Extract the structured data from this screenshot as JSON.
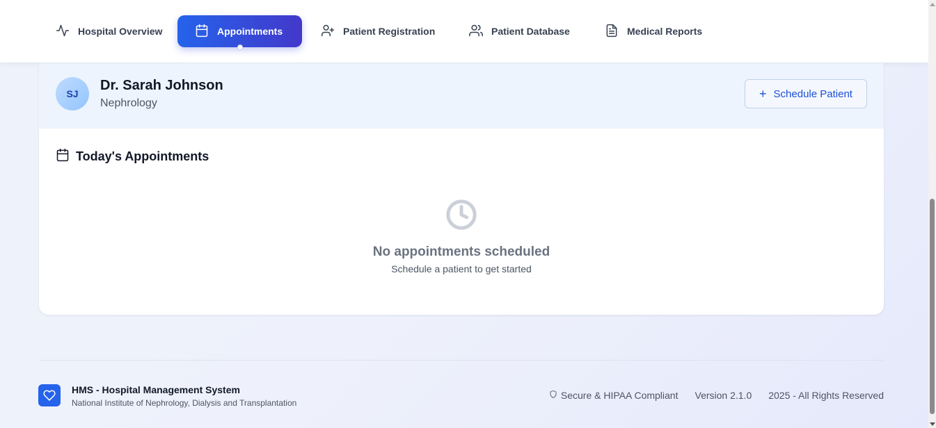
{
  "nav": {
    "tabs": [
      {
        "label": "Hospital Overview",
        "icon": "activity-icon",
        "active": false
      },
      {
        "label": "Appointments",
        "icon": "calendar-icon",
        "active": true
      },
      {
        "label": "Patient Registration",
        "icon": "user-plus-icon",
        "active": false
      },
      {
        "label": "Patient Database",
        "icon": "users-icon",
        "active": false
      },
      {
        "label": "Medical Reports",
        "icon": "file-text-icon",
        "active": false
      }
    ]
  },
  "doctor": {
    "initials": "SJ",
    "name": "Dr. Sarah Johnson",
    "specialty": "Nephrology",
    "schedule_button_label": "Schedule Patient",
    "schedule_button_icon": "plus-icon"
  },
  "appointments": {
    "title": "Today's Appointments",
    "title_icon": "calendar-icon",
    "empty_icon": "clock-icon",
    "empty_title": "No appointments scheduled",
    "empty_subtitle": "Schedule a patient to get started"
  },
  "footer": {
    "logo_icon": "heart-icon",
    "title": "HMS - Hospital Management System",
    "subtitle": "National Institute of Nephrology, Dialysis and Transplantation",
    "secure_icon": "shield-icon",
    "secure_label": "Secure & HIPAA Compliant",
    "version": "Version 2.1.0",
    "copyright": "2025 - All Rights Reserved"
  },
  "colors": {
    "accent": "#2563eb",
    "accent_end": "#4338ca",
    "doctor_header_bg": "#edf4fd",
    "page_bg": "#eef1fb"
  }
}
